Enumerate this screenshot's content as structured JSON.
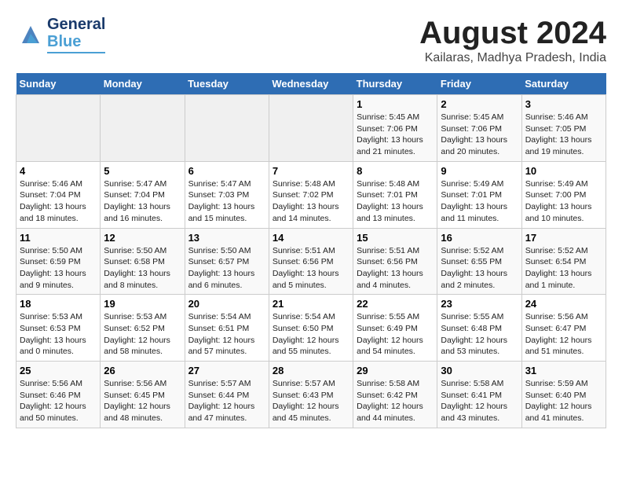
{
  "header": {
    "logo_line1": "General",
    "logo_line2": "Blue",
    "month_title": "August 2024",
    "location": "Kailaras, Madhya Pradesh, India"
  },
  "weekdays": [
    "Sunday",
    "Monday",
    "Tuesday",
    "Wednesday",
    "Thursday",
    "Friday",
    "Saturday"
  ],
  "weeks": [
    [
      {
        "day": "",
        "info": ""
      },
      {
        "day": "",
        "info": ""
      },
      {
        "day": "",
        "info": ""
      },
      {
        "day": "",
        "info": ""
      },
      {
        "day": "1",
        "info": "Sunrise: 5:45 AM\nSunset: 7:06 PM\nDaylight: 13 hours\nand 21 minutes."
      },
      {
        "day": "2",
        "info": "Sunrise: 5:45 AM\nSunset: 7:06 PM\nDaylight: 13 hours\nand 20 minutes."
      },
      {
        "day": "3",
        "info": "Sunrise: 5:46 AM\nSunset: 7:05 PM\nDaylight: 13 hours\nand 19 minutes."
      }
    ],
    [
      {
        "day": "4",
        "info": "Sunrise: 5:46 AM\nSunset: 7:04 PM\nDaylight: 13 hours\nand 18 minutes."
      },
      {
        "day": "5",
        "info": "Sunrise: 5:47 AM\nSunset: 7:04 PM\nDaylight: 13 hours\nand 16 minutes."
      },
      {
        "day": "6",
        "info": "Sunrise: 5:47 AM\nSunset: 7:03 PM\nDaylight: 13 hours\nand 15 minutes."
      },
      {
        "day": "7",
        "info": "Sunrise: 5:48 AM\nSunset: 7:02 PM\nDaylight: 13 hours\nand 14 minutes."
      },
      {
        "day": "8",
        "info": "Sunrise: 5:48 AM\nSunset: 7:01 PM\nDaylight: 13 hours\nand 13 minutes."
      },
      {
        "day": "9",
        "info": "Sunrise: 5:49 AM\nSunset: 7:01 PM\nDaylight: 13 hours\nand 11 minutes."
      },
      {
        "day": "10",
        "info": "Sunrise: 5:49 AM\nSunset: 7:00 PM\nDaylight: 13 hours\nand 10 minutes."
      }
    ],
    [
      {
        "day": "11",
        "info": "Sunrise: 5:50 AM\nSunset: 6:59 PM\nDaylight: 13 hours\nand 9 minutes."
      },
      {
        "day": "12",
        "info": "Sunrise: 5:50 AM\nSunset: 6:58 PM\nDaylight: 13 hours\nand 8 minutes."
      },
      {
        "day": "13",
        "info": "Sunrise: 5:50 AM\nSunset: 6:57 PM\nDaylight: 13 hours\nand 6 minutes."
      },
      {
        "day": "14",
        "info": "Sunrise: 5:51 AM\nSunset: 6:56 PM\nDaylight: 13 hours\nand 5 minutes."
      },
      {
        "day": "15",
        "info": "Sunrise: 5:51 AM\nSunset: 6:56 PM\nDaylight: 13 hours\nand 4 minutes."
      },
      {
        "day": "16",
        "info": "Sunrise: 5:52 AM\nSunset: 6:55 PM\nDaylight: 13 hours\nand 2 minutes."
      },
      {
        "day": "17",
        "info": "Sunrise: 5:52 AM\nSunset: 6:54 PM\nDaylight: 13 hours\nand 1 minute."
      }
    ],
    [
      {
        "day": "18",
        "info": "Sunrise: 5:53 AM\nSunset: 6:53 PM\nDaylight: 13 hours\nand 0 minutes."
      },
      {
        "day": "19",
        "info": "Sunrise: 5:53 AM\nSunset: 6:52 PM\nDaylight: 12 hours\nand 58 minutes."
      },
      {
        "day": "20",
        "info": "Sunrise: 5:54 AM\nSunset: 6:51 PM\nDaylight: 12 hours\nand 57 minutes."
      },
      {
        "day": "21",
        "info": "Sunrise: 5:54 AM\nSunset: 6:50 PM\nDaylight: 12 hours\nand 55 minutes."
      },
      {
        "day": "22",
        "info": "Sunrise: 5:55 AM\nSunset: 6:49 PM\nDaylight: 12 hours\nand 54 minutes."
      },
      {
        "day": "23",
        "info": "Sunrise: 5:55 AM\nSunset: 6:48 PM\nDaylight: 12 hours\nand 53 minutes."
      },
      {
        "day": "24",
        "info": "Sunrise: 5:56 AM\nSunset: 6:47 PM\nDaylight: 12 hours\nand 51 minutes."
      }
    ],
    [
      {
        "day": "25",
        "info": "Sunrise: 5:56 AM\nSunset: 6:46 PM\nDaylight: 12 hours\nand 50 minutes."
      },
      {
        "day": "26",
        "info": "Sunrise: 5:56 AM\nSunset: 6:45 PM\nDaylight: 12 hours\nand 48 minutes."
      },
      {
        "day": "27",
        "info": "Sunrise: 5:57 AM\nSunset: 6:44 PM\nDaylight: 12 hours\nand 47 minutes."
      },
      {
        "day": "28",
        "info": "Sunrise: 5:57 AM\nSunset: 6:43 PM\nDaylight: 12 hours\nand 45 minutes."
      },
      {
        "day": "29",
        "info": "Sunrise: 5:58 AM\nSunset: 6:42 PM\nDaylight: 12 hours\nand 44 minutes."
      },
      {
        "day": "30",
        "info": "Sunrise: 5:58 AM\nSunset: 6:41 PM\nDaylight: 12 hours\nand 43 minutes."
      },
      {
        "day": "31",
        "info": "Sunrise: 5:59 AM\nSunset: 6:40 PM\nDaylight: 12 hours\nand 41 minutes."
      }
    ]
  ]
}
